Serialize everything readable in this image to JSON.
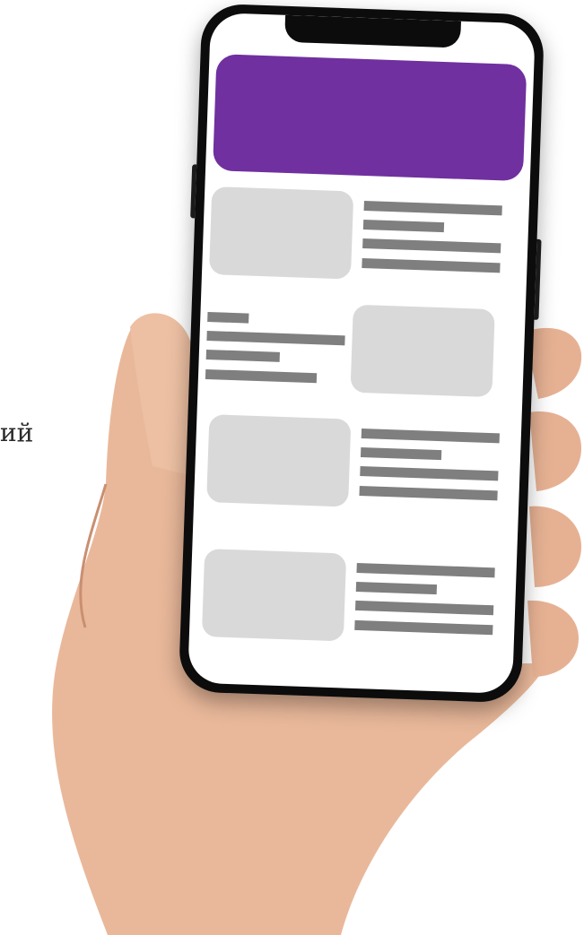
{
  "page": {
    "side_text": "ий"
  },
  "phone": {
    "app_screen": {
      "hero_banner": {
        "color": "#7030a0"
      },
      "placeholder_colors": {
        "thumbnail": "#d9d9d9",
        "text_line": "#7f7f7f"
      },
      "cards": [
        {
          "image_side": "left"
        },
        {
          "image_side": "right"
        },
        {
          "image_side": "left"
        },
        {
          "image_side": "left"
        }
      ]
    }
  }
}
